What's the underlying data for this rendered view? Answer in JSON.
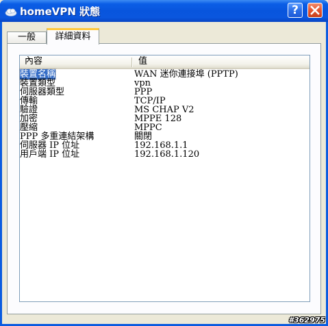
{
  "window": {
    "title": "homeVPN 狀態",
    "help_label": "?",
    "icons": {
      "app": "network-cloud-icon",
      "help": "help-icon",
      "close": "close-icon"
    },
    "colors": {
      "titlebar": "#0855dd",
      "selection": "#316ac5",
      "tab_highlight": "#ffc83c"
    }
  },
  "tabs": [
    {
      "label": "一般",
      "active": false
    },
    {
      "label": "詳細資料",
      "active": true
    }
  ],
  "list": {
    "columns": [
      "內容",
      "值"
    ],
    "rows": [
      {
        "property": "裝置名稱",
        "value": "WAN 迷你連接埠 (PPTP)",
        "selected": true
      },
      {
        "property": "裝置類型",
        "value": "vpn"
      },
      {
        "property": "伺服器類型",
        "value": "PPP"
      },
      {
        "property": "傳輸",
        "value": "TCP/IP"
      },
      {
        "property": "驗證",
        "value": "MS CHAP V2"
      },
      {
        "property": "加密",
        "value": "MPPE 128"
      },
      {
        "property": "壓縮",
        "value": "MPPC"
      },
      {
        "property": "PPP 多重連結架構",
        "value": "關閉"
      },
      {
        "property": "伺服器 IP 位址",
        "value": "192.168.1.1"
      },
      {
        "property": "用戶端 IP 位址",
        "value": "192.168.1.120"
      }
    ]
  },
  "watermark": "#362975"
}
